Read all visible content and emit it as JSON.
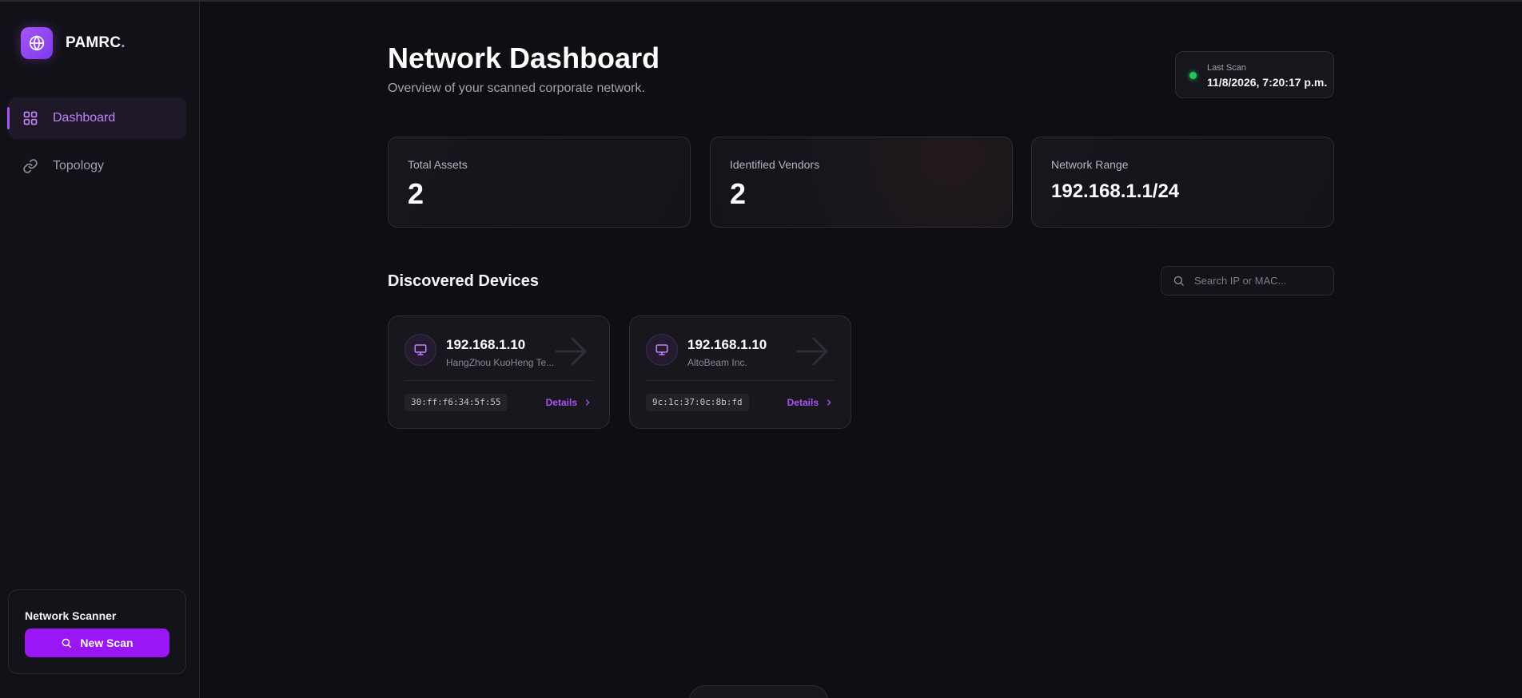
{
  "brand": {
    "name": "PAMRC",
    "dot": "."
  },
  "nav": {
    "items": [
      {
        "label": "Dashboard",
        "icon": "grid-icon",
        "active": true
      },
      {
        "label": "Topology",
        "icon": "link-icon",
        "active": false
      }
    ]
  },
  "scanner": {
    "title": "Network Scanner",
    "button_label": "New Scan"
  },
  "header": {
    "title": "Network Dashboard",
    "subtitle": "Overview of your scanned corporate network.",
    "last_scan_label": "Last Scan",
    "last_scan_value": "11/8/2026, 7:20:17 p.m."
  },
  "stats": {
    "total_assets": {
      "label": "Total Assets",
      "value": "2"
    },
    "vendors": {
      "label": "Identified Vendors",
      "value": "2"
    },
    "range": {
      "label": "Network Range",
      "value": "192.168.1.1/24"
    }
  },
  "devices_section": {
    "title": "Discovered Devices",
    "search_placeholder": "Search IP or MAC..."
  },
  "devices": [
    {
      "ip": "192.168.1.10",
      "vendor": "HangZhou KuoHeng Te...",
      "mac": "30:ff:f6:34:5f:55",
      "details_label": "Details"
    },
    {
      "ip": "192.168.1.10",
      "vendor": "AltoBeam Inc.",
      "mac": "9c:1c:37:0c:8b:fd",
      "details_label": "Details"
    }
  ],
  "colors": {
    "accent": "#a855f7",
    "button": "#9b16f5",
    "status_online": "#22c55e",
    "background": "#0f0e13"
  }
}
